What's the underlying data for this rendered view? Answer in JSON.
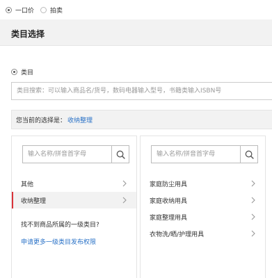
{
  "sale_type": {
    "options": [
      {
        "label": "一口价",
        "checked": true
      },
      {
        "label": "拍卖",
        "checked": false
      }
    ]
  },
  "header": {
    "title": "类目选择"
  },
  "category_mode": {
    "label": "类目",
    "checked": true
  },
  "category_search": {
    "placeholder": "类目搜索：可以输入商品名/货号，数码电器输入型号，书籍类输入ISBN号"
  },
  "current_selection": {
    "prefix": "您当前的选择是：",
    "value": "收纳整理"
  },
  "left_panel": {
    "search_placeholder": "输入名称/拼音首字母",
    "items": [
      {
        "label": "其他",
        "active": false
      },
      {
        "label": "收纳整理",
        "active": true
      }
    ],
    "not_found_text": "找不到商品所属的一级类目?",
    "apply_link": "申请更多一级类目发布权限"
  },
  "right_panel": {
    "search_placeholder": "输入名称/拼音首字母",
    "items": [
      {
        "label": "家庭防尘用具"
      },
      {
        "label": "家庭收纳用具"
      },
      {
        "label": "家庭整理用具"
      },
      {
        "label": "衣物洗/晒/护理用具"
      }
    ]
  },
  "colors": {
    "link": "#2a72c7",
    "active_marker": "#d9333a",
    "header_bg": "#f2f2f2"
  },
  "icons": {
    "search": "magnifier-icon",
    "chevron": "chevron-right-icon"
  }
}
